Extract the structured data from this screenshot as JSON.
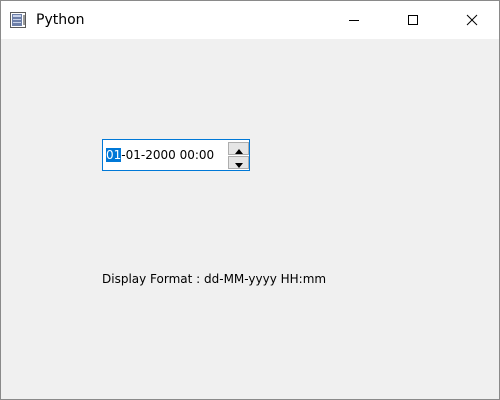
{
  "window": {
    "title": "Python",
    "controls": {
      "minimize_icon": "minimize-icon",
      "maximize_icon": "maximize-icon",
      "close_icon": "close-icon"
    }
  },
  "datetime_edit": {
    "selected_section": "01",
    "rest_text": "-01-2000 00:00",
    "spin_up_icon": "arrow-up-icon",
    "spin_down_icon": "arrow-down-icon"
  },
  "format_label": "Display Format : dd-MM-yyyy HH:mm",
  "colors": {
    "accent": "#0078d7",
    "background": "#f0f0f0",
    "titlebar": "#ffffff"
  }
}
